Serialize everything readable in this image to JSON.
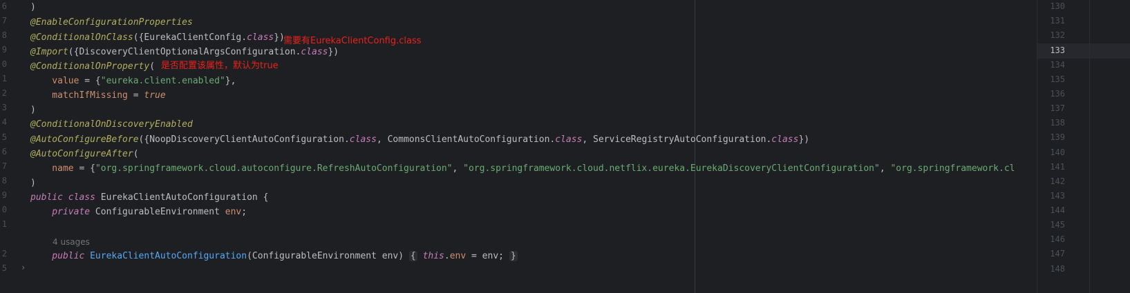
{
  "gutter": {
    "line_numbers": [
      "6",
      "7",
      "8",
      "9",
      "0",
      "1",
      "2",
      "3",
      "4",
      "5",
      "6",
      "7",
      "8",
      "9",
      "0",
      "1",
      "",
      "2",
      "5"
    ]
  },
  "code": {
    "l1": ")",
    "l2_ann": "@EnableConfigurationProperties",
    "l3_ann": "@ConditionalOnClass",
    "l3_a": "({EurekaClientConfig.",
    "l3_kw": "class",
    "l3_b": "})",
    "l4_ann": "@Import",
    "l4_a": "({DiscoveryClientOptionalArgsConfiguration.",
    "l4_kw": "class",
    "l4_b": "})",
    "l5_ann": "@ConditionalOnProperty",
    "l5_a": "(",
    "l6_attr": "    value",
    "l6_a": " = {",
    "l6_str": "\"eureka.client.enabled\"",
    "l6_b": "},",
    "l7_attr": "    matchIfMissing",
    "l7_a": " = ",
    "l7_kw": "true",
    "l8": ")",
    "l9_ann": "@ConditionalOnDiscoveryEnabled",
    "l10_ann": "@AutoConfigureBefore",
    "l10_a": "({NoopDiscoveryClientAutoConfiguration.",
    "l10_kw1": "class",
    "l10_b": ", CommonsClientAutoConfiguration.",
    "l10_kw2": "class",
    "l10_c": ", ServiceRegistryAutoConfiguration.",
    "l10_kw3": "class",
    "l10_d": "})",
    "l11_ann": "@AutoConfigureAfter",
    "l11_a": "(",
    "l12_attr": "    name",
    "l12_a": " = {",
    "l12_s1": "\"org.springframework.cloud.autoconfigure.RefreshAutoConfiguration\"",
    "l12_b": ", ",
    "l12_s2": "\"org.springframework.cloud.netflix.eureka.EurekaDiscoveryClientConfiguration\"",
    "l12_c": ", ",
    "l12_s3": "\"org.springframework.cl",
    "l13": ")",
    "l14_kw1": "public",
    "l14_kw2": "class",
    "l14_a": " EurekaClientAutoConfiguration {",
    "l15_kw": "    private",
    "l15_a": " ConfigurableEnvironment ",
    "l15_f": "env",
    "l15_b": ";",
    "usages": "4 usages",
    "l17_kw": "    public",
    "l17_m": "EurekaClientAutoConfiguration",
    "l17_a": "(ConfigurableEnvironment env) ",
    "l17_open": "{",
    "l17_this": "this",
    "l17_dot": ".",
    "l17_f": "env",
    "l17_b": " = env; ",
    "l17_close": "}"
  },
  "annotations": {
    "note1": "需要有EurekaClientConfig.class",
    "note2": "是否配置该属性，默认为true"
  },
  "right_gutter": {
    "line_numbers": [
      "130",
      "131",
      "132",
      "133",
      "134",
      "135",
      "136",
      "137",
      "138",
      "139",
      "140",
      "141",
      "142",
      "143",
      "144",
      "145",
      "146",
      "147",
      "148"
    ],
    "current_line": "133"
  },
  "colors": {
    "background": "#1e1f22",
    "annotation": "#b3ae60",
    "keyword": "#cf8e6d",
    "string": "#6aab73",
    "field": "#c77dbb",
    "method": "#56a8f5",
    "note_red": "#e8221d"
  },
  "icons": {
    "fold": "chevron-right-icon"
  }
}
